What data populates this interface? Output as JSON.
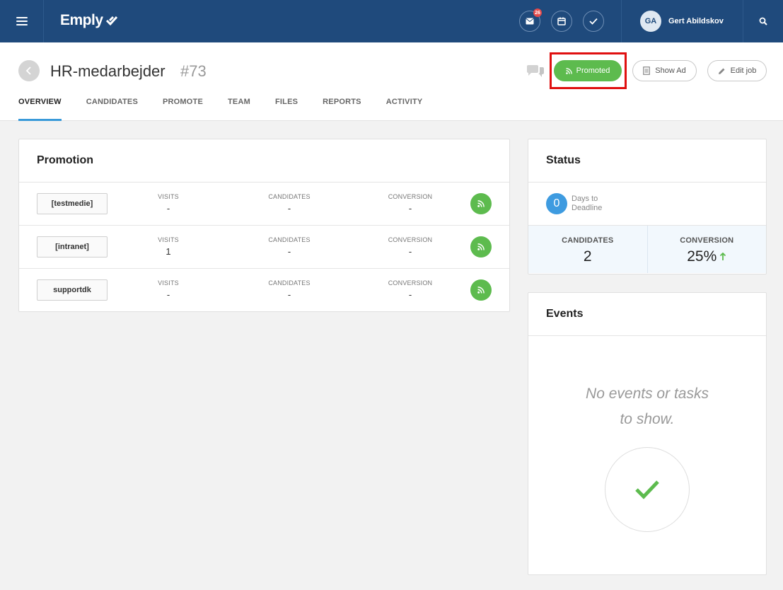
{
  "topbar": {
    "logo": "Emply",
    "mail_badge": "26",
    "user_initials": "GA",
    "user_name": "Gert Abildskov"
  },
  "header": {
    "title": "HR-medarbejder",
    "number": "#73",
    "promoted_label": "Promoted",
    "show_ad_label": "Show Ad",
    "edit_job_label": "Edit job"
  },
  "tabs": [
    {
      "label": "OVERVIEW",
      "active": true
    },
    {
      "label": "CANDIDATES"
    },
    {
      "label": "PROMOTE"
    },
    {
      "label": "TEAM"
    },
    {
      "label": "FILES"
    },
    {
      "label": "REPORTS"
    },
    {
      "label": "ACTIVITY"
    }
  ],
  "promotion": {
    "title": "Promotion",
    "labels": {
      "visits": "VISITS",
      "candidates": "CANDIDATES",
      "conversion": "CONVERSION"
    },
    "rows": [
      {
        "medium": "[testmedie]",
        "visits": "-",
        "candidates": "-",
        "conversion": "-"
      },
      {
        "medium": "[intranet]",
        "visits": "1",
        "candidates": "-",
        "conversion": "-"
      },
      {
        "medium": "supportdk",
        "visits": "-",
        "candidates": "-",
        "conversion": "-"
      }
    ]
  },
  "status": {
    "title": "Status",
    "days": "0",
    "days_label": "Days to Deadline",
    "candidates_label": "CANDIDATES",
    "candidates_value": "2",
    "conversion_label": "CONVERSION",
    "conversion_value": "25%"
  },
  "events": {
    "title": "Events",
    "empty_line1": "No events or tasks",
    "empty_line2": "to show."
  },
  "colors": {
    "topbar": "#1f4a7c",
    "accent_green": "#5dbb4e",
    "accent_blue": "#3a9ad9",
    "highlight_red": "#e01010"
  }
}
